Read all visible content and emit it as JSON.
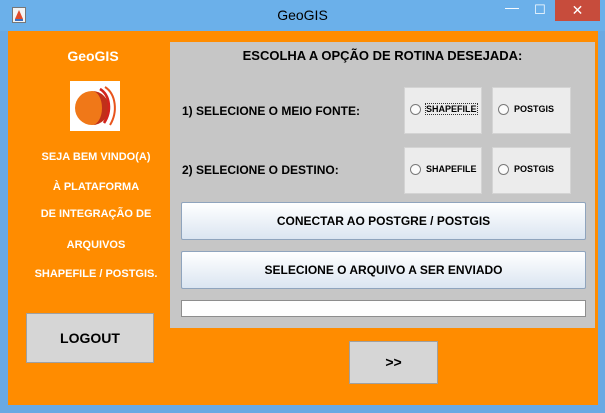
{
  "window": {
    "title": "GeoGIS",
    "minimize": "—",
    "maximize": "☐",
    "close": "✕"
  },
  "sidebar": {
    "title": "GeoGIS",
    "welcome_lines": [
      "SEJA BEM VINDO(A)",
      "À PLATAFORMA",
      "DE INTEGRAÇÃO DE",
      "ARQUIVOS",
      "SHAPEFILE / POSTGIS."
    ],
    "logout_label": "LOGOUT"
  },
  "panel": {
    "title": "ESCOLHA A OPÇÃO DE ROTINA DESEJADA:",
    "source_label": "1) SELECIONE O MEIO FONTE:",
    "dest_label": "2) SELECIONE O DESTINO:",
    "source_options": [
      "SHAPEFILE",
      "POSTGIS"
    ],
    "dest_options": [
      "SHAPEFILE",
      "POSTGIS"
    ],
    "connect_button": "CONECTAR AO POSTGRE / POSTGIS",
    "select_file_button": "SELECIONE O ARQUIVO A SER ENVIADO",
    "progress": 0
  },
  "next_button": ">>",
  "colors": {
    "background": "#ff8c00",
    "panel": "#c6c6c6",
    "titlebar": "#6bb0ea",
    "close": "#c74c3c"
  }
}
